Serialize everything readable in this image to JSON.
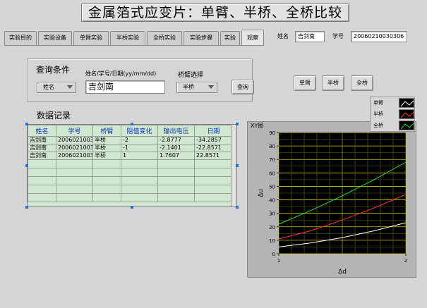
{
  "title": "金属箔式应变片：单臂、半桥、全桥比较",
  "tabs": [
    "实验目的",
    "实验设备",
    "单臂实验",
    "半桥实验",
    "全桥实验",
    "实验步骤",
    "实验",
    "观察"
  ],
  "active_tab": "观察",
  "header": {
    "name_label": "姓名",
    "name_value": "吉剑南",
    "id_label": "学号",
    "id_value": "20060210030306"
  },
  "query": {
    "title": "查询条件",
    "condition_dropdown": "姓名",
    "input_label": "姓名/学号/日期(yy/mm/dd)",
    "input_value": "吉剑南",
    "arm_label": "桥臂选择",
    "arm_dropdown": "半桥",
    "query_button": "查询"
  },
  "buttons": {
    "single": "单臂",
    "half": "半桥",
    "full": "全桥"
  },
  "records": {
    "title": "数据记录",
    "columns": [
      "姓名",
      "学号",
      "桥臂",
      "阻值变化",
      "输出电压",
      "日期"
    ],
    "rows": [
      [
        "吉剑南",
        "2006021003",
        "半桥",
        "-2",
        "-2.8777",
        "-34.2857"
      ],
      [
        "吉剑南",
        "2006021003",
        "半桥",
        "-1",
        "-2.1401",
        "-22.8571"
      ],
      [
        "吉剑南",
        "2006021003",
        "半桥",
        "1",
        "1.7607",
        "22.8571"
      ]
    ]
  },
  "legend": [
    {
      "name": "单臂",
      "color": "#ffffff"
    },
    {
      "name": "半桥",
      "color": "#ff3030"
    },
    {
      "name": "全桥",
      "color": "#22dd22"
    }
  ],
  "chart_data": {
    "type": "line",
    "title": "XY图",
    "xlabel": "Δd",
    "ylabel": "Δu",
    "xlim": [
      1,
      2
    ],
    "ylim": [
      0,
      90
    ],
    "x_ticks": [
      "1",
      "2"
    ],
    "y_ticks": [
      "0",
      "10",
      "20",
      "30",
      "40",
      "50",
      "60",
      "70",
      "80",
      "90"
    ],
    "grid": true,
    "series": [
      {
        "name": "单臂",
        "color": "#ffffff",
        "x": [
          1,
          1.25,
          1.5,
          1.75,
          2
        ],
        "y": [
          5,
          8,
          12,
          17,
          23
        ]
      },
      {
        "name": "半桥",
        "color": "#ff3030",
        "x": [
          1,
          1.25,
          1.5,
          1.75,
          2
        ],
        "y": [
          11,
          17,
          25,
          34,
          44
        ]
      },
      {
        "name": "全桥",
        "color": "#22dd22",
        "x": [
          1,
          1.25,
          1.5,
          1.75,
          2
        ],
        "y": [
          22,
          32,
          43,
          55,
          68
        ]
      }
    ]
  }
}
